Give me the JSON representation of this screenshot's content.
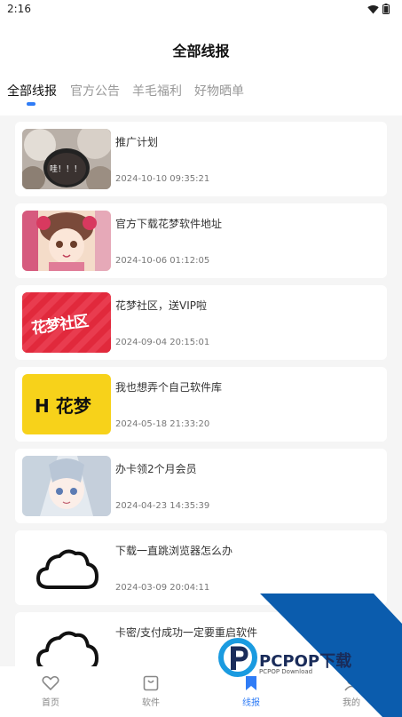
{
  "status_bar": {
    "time": "2:16"
  },
  "header": {
    "title": "全部线报"
  },
  "tabs": [
    {
      "label": "全部线报",
      "active": true
    },
    {
      "label": "官方公告",
      "active": false
    },
    {
      "label": "羊毛福利",
      "active": false
    },
    {
      "label": "好物晒单",
      "active": false
    }
  ],
  "posts": [
    {
      "title": "推广计划",
      "date": "2024-10-10 09:35:21",
      "thumb_text": "哇！！！"
    },
    {
      "title": "官方下载花梦软件地址",
      "date": "2024-10-06 01:12:05"
    },
    {
      "title": "花梦社区，送VIP啦",
      "date": "2024-09-04 20:15:01",
      "thumb_text": "花梦社区"
    },
    {
      "title": "我也想弄个自己软件库",
      "date": "2024-05-18 21:33:20",
      "thumb_text": "H 花梦"
    },
    {
      "title": "办卡领2个月会员",
      "date": "2024-04-23 14:35:39"
    },
    {
      "title": "下载一直跳浏览器怎么办",
      "date": "2024-03-09 20:04:11"
    },
    {
      "title": "卡密/支付成功一定要重启软件",
      "date": ""
    }
  ],
  "watermark": {
    "brand": "PCPOP下载",
    "sub": "PCPOP Download"
  },
  "bottom_nav": [
    {
      "label": "首页",
      "icon": "heart-icon"
    },
    {
      "label": "软件",
      "icon": "bag-icon"
    },
    {
      "label": "线报",
      "icon": "bookmark-icon",
      "active": true
    },
    {
      "label": "我的",
      "icon": "user-icon"
    }
  ],
  "colors": {
    "accent": "#2f7cf6",
    "watermark_blue": "#0b5cad"
  }
}
